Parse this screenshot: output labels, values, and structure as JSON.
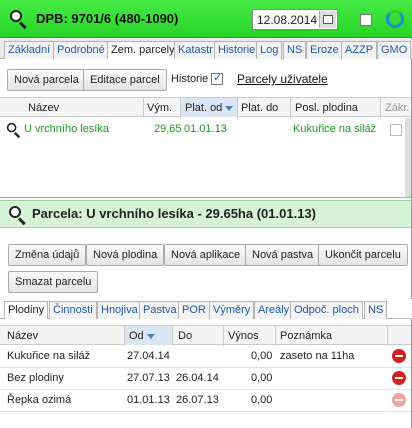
{
  "header": {
    "title": "DPB: 9701/6 (480-1090)",
    "date": "12.08.2014",
    "icons": [
      "search-icon",
      "calendar-icon",
      "refresh-icon"
    ],
    "colors": {
      "header_green": "#2fd82f",
      "tab_link": "#1d5ab2",
      "crop_green": "#1a9a1a",
      "delete_red": "#d42020"
    }
  },
  "tabs": [
    "Základní",
    "Podrobné",
    "Zem. parcely",
    "Katastr",
    "Historie",
    "Log",
    "NS",
    "Eroze",
    "AZZP",
    "GMO"
  ],
  "active_tab": "Zem. parcely",
  "toolbar": {
    "new_parcel": "Nová parcela",
    "edit_parcel": "Editace parcel",
    "history_label": "Historie",
    "history_checked": true,
    "user_parcels_link": "Parcely uživatele"
  },
  "parcel_grid": {
    "columns": [
      "Název",
      "Vým.",
      "Plat. od",
      "Plat. do",
      "Posl. plodina",
      "Zákr."
    ],
    "rows": [
      {
        "name": "U vrchního lesíka",
        "area": "29,65",
        "valid_from": "01.01.13",
        "valid_to": "",
        "last_crop": "Kukuřice na siláž"
      }
    ]
  },
  "parcel_detail": {
    "title": "Parcela: U vrchního lesíka - 29.65ha (01.01.13)",
    "buttons": [
      "Změna údajů",
      "Nová plodina",
      "Nová aplikace",
      "Nová pastva",
      "Ukončit parcelu",
      "Smazat parcelu"
    ]
  },
  "subtabs": [
    "Plodiny",
    "Činnosti",
    "Hnojiva",
    "Pastva",
    "POR",
    "Výměry",
    "Areály",
    "Odpoč. ploch",
    "NS"
  ],
  "active_subtab": "Plodiny",
  "crop_grid": {
    "columns": [
      "Název",
      "Od",
      "Do",
      "Výnos",
      "Poznámka"
    ],
    "rows": [
      {
        "name": "Kukuřice na siláž",
        "from": "27.04.14",
        "to": "",
        "yield": "0,00",
        "note": "zaseto na 11ha"
      },
      {
        "name": "Bez plodiny",
        "from": "27.07.13",
        "to": "26.04.14",
        "yield": "0,00",
        "note": ""
      },
      {
        "name": "Řepka ozimá",
        "from": "01.01.13",
        "to": "26.07.13",
        "yield": "0,00",
        "note": ""
      }
    ]
  }
}
